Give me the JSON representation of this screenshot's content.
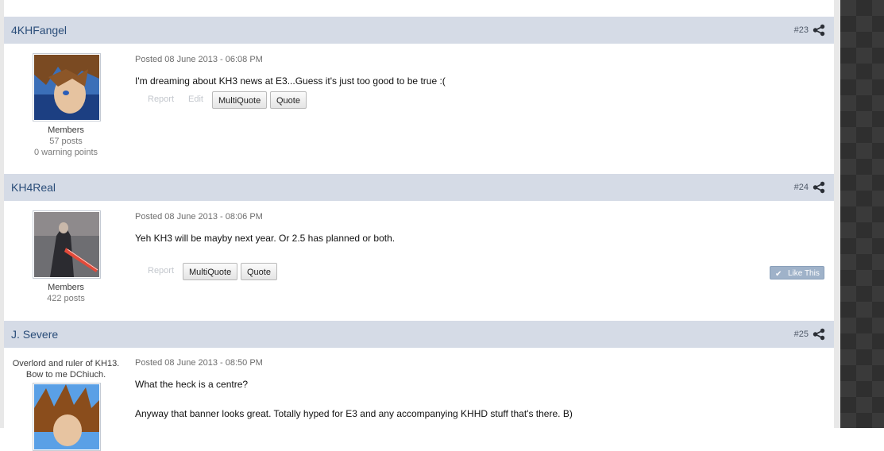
{
  "posts": [
    {
      "author": "4KHFangel",
      "number": "#23",
      "posted": "Posted 08 June 2013 - 06:08 PM",
      "body": [
        "I'm dreaming about KH3 news at E3...Guess it's just too good to be true :("
      ],
      "group": "Members",
      "posts_count": "57 posts",
      "warning": "0 warning points",
      "actions": {
        "report": "Report",
        "edit": "Edit",
        "multiquote": "MultiQuote",
        "quote": "Quote"
      }
    },
    {
      "author": "KH4Real",
      "number": "#24",
      "posted": "Posted 08 June 2013 - 08:06 PM",
      "body": [
        "Yeh KH3 will be mayby next year. Or 2.5 has planned or both."
      ],
      "group": "Members",
      "posts_count": "422 posts",
      "actions": {
        "report": "Report",
        "multiquote": "MultiQuote",
        "quote": "Quote",
        "like": "Like This"
      }
    },
    {
      "author": "J. Severe",
      "number": "#25",
      "user_title": [
        "Overlord and ruler of KH13.",
        "Bow to me DChiuch."
      ],
      "posted": "Posted 08 June 2013 - 08:50 PM",
      "body": [
        "What the heck is a centre?",
        "Anyway that banner looks great. Totally hyped for E3 and any accompanying KHHD stuff that's there. B)"
      ]
    }
  ],
  "icons": {
    "share": "share-icon",
    "like_check": "check-icon"
  },
  "colors": {
    "header_bg": "#d5dbe6",
    "author_link": "#2a4d79",
    "like_button": "#9fb2c9"
  }
}
